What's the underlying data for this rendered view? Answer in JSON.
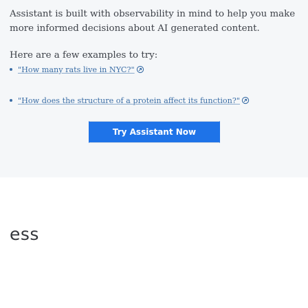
{
  "intro_text": "Assistant is built with observability in mind to help you make more informed decisions about AI generated content.",
  "examples_heading": "Here are a few examples to try:",
  "examples": [
    {
      "text": "\"How many rats live in NYC?\""
    },
    {
      "text": "\"How does the structure of a protein affect its function?\""
    }
  ],
  "cta_label": "Try Assistant Now",
  "partial_heading": "ess",
  "colors": {
    "panel_background": "#f5f7f9",
    "link": "#3b6ea6",
    "button": "#1e73e8",
    "text": "#3d4148"
  },
  "icons": [
    "bullet",
    "open-in-new-icon"
  ]
}
